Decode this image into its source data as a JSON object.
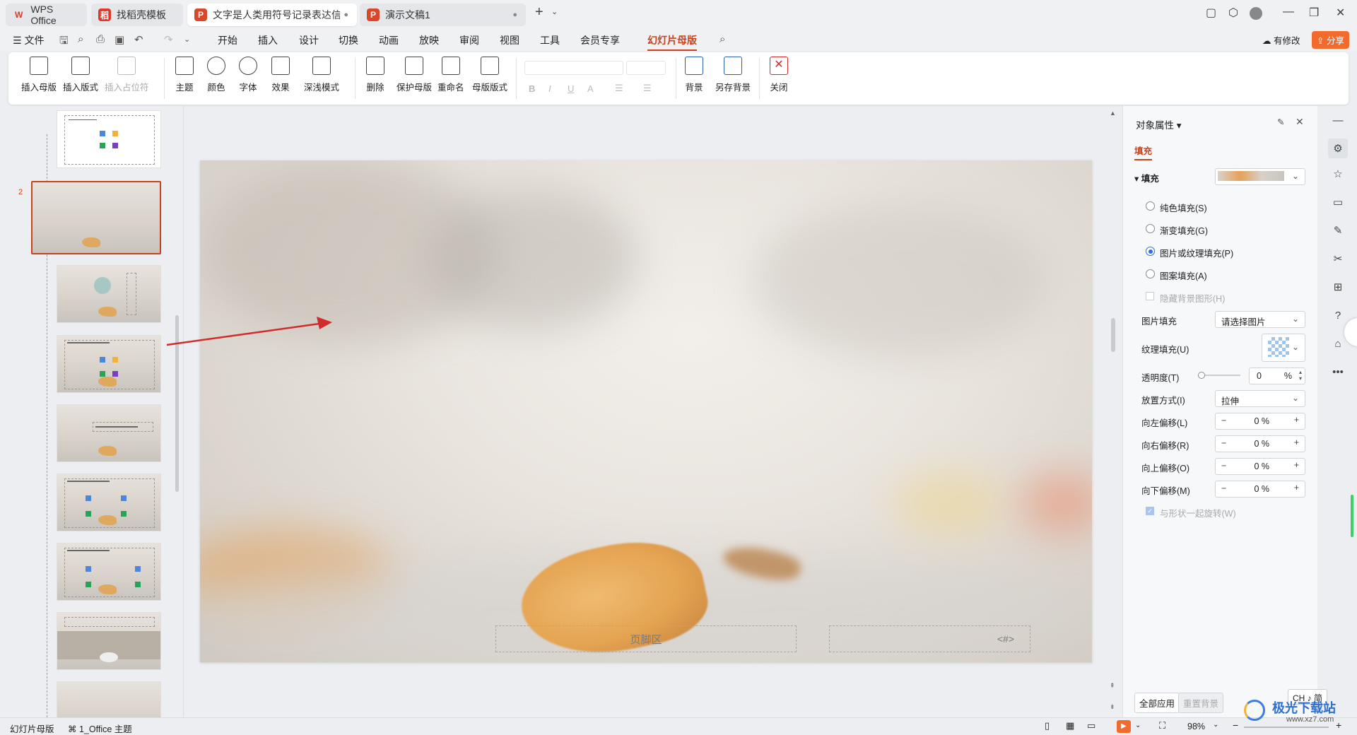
{
  "tabs": [
    {
      "label": "WPS Office",
      "icon": "wps-logo-icon"
    },
    {
      "label": "找稻壳模板",
      "icon": "docer-icon"
    },
    {
      "label": "文字是人类用符号记录表达信息以",
      "icon": "ppt-icon"
    },
    {
      "label": "演示文稿1",
      "icon": "ppt-icon"
    }
  ],
  "menu": {
    "file": "文件",
    "items": [
      "开始",
      "插入",
      "设计",
      "切换",
      "动画",
      "放映",
      "审阅",
      "视图",
      "工具",
      "会员专享",
      "幻灯片母版"
    ],
    "status_modified": "有修改",
    "share": "分享"
  },
  "ribbon": {
    "group1": [
      "插入母版",
      "插入版式",
      "插入占位符"
    ],
    "group2": [
      "主题",
      "颜色",
      "字体",
      "效果",
      "深浅模式"
    ],
    "group3": [
      "删除",
      "保护母版",
      "重命名",
      "母版版式"
    ],
    "format": [
      "B",
      "I",
      "U",
      "A"
    ],
    "group4": [
      "背景",
      "另存背景"
    ],
    "close": "关闭"
  },
  "slides": {
    "master_number": "2"
  },
  "slide": {
    "footer": "页脚区",
    "page_number": "<#>"
  },
  "panel": {
    "title": "对象属性",
    "tab": "填充",
    "section": "填充",
    "options": [
      {
        "label": "纯色填充(S)",
        "checked": false
      },
      {
        "label": "渐变填充(G)",
        "checked": false
      },
      {
        "label": "图片或纹理填充(P)",
        "checked": true
      },
      {
        "label": "图案填充(A)",
        "checked": false
      }
    ],
    "hide_bg": "隐藏背景图形(H)",
    "picture_fill_label": "图片填充",
    "picture_fill_value": "请选择图片",
    "texture_label": "纹理填充(U)",
    "transparency_label": "透明度(T)",
    "transparency_value": "0",
    "percent": "%",
    "placement_label": "放置方式(I)",
    "placement_value": "拉伸",
    "offsets": [
      {
        "label": "向左偏移(L)",
        "value": "0 %"
      },
      {
        "label": "向右偏移(R)",
        "value": "0 %"
      },
      {
        "label": "向上偏移(O)",
        "value": "0 %"
      },
      {
        "label": "向下偏移(M)",
        "value": "0 %"
      }
    ],
    "rotate_with_shape": "与形状一起旋转(W)",
    "apply_all": "全部应用",
    "reset_bg": "重置背景"
  },
  "status": {
    "mode": "幻灯片母版",
    "theme": "1_Office 主题",
    "zoom": "98%",
    "ime": "CH ♪ 简"
  },
  "watermark": "极光下载站",
  "watermark_url": "www.xz7.com",
  "colors": {
    "accent": "#c7431f",
    "share": "#f36b2c",
    "radio": "#2b6de5",
    "arrow": "#d22b2b"
  }
}
